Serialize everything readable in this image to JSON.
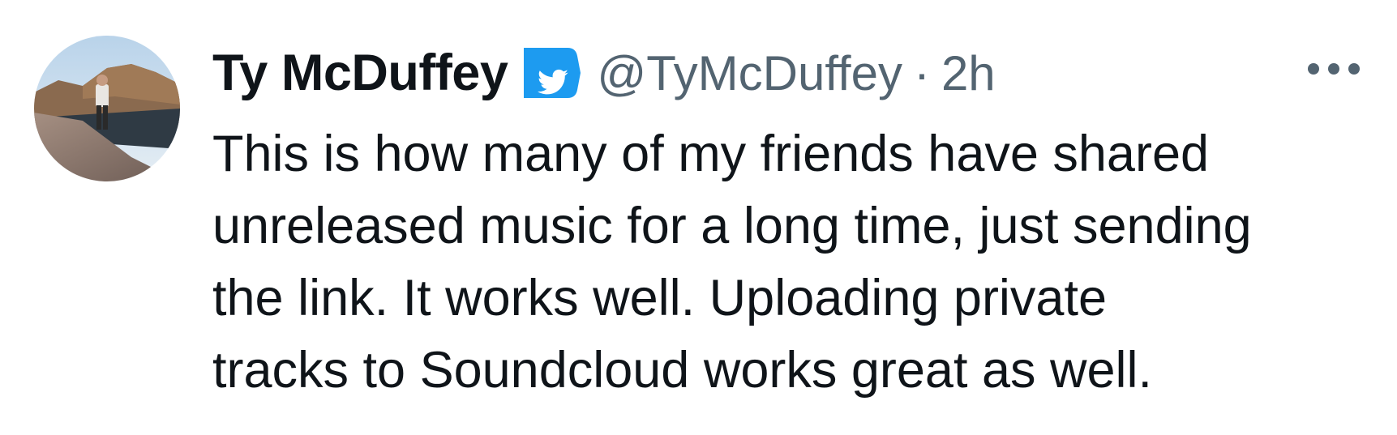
{
  "tweet": {
    "author": {
      "display_name": "Ty McDuffey",
      "handle": "@TyMcDuffey",
      "verified": true,
      "avatar_icon": "profile-photo-landscape"
    },
    "separator": "·",
    "timestamp": "2h",
    "more_icon": "more-horizontal-icon",
    "text": "This is how many of my friends have shared\nunreleased music for a long time, just sending\nthe link. It works well. Uploading private\ntracks to Soundcloud works great as well."
  },
  "colors": {
    "text_primary": "#0f1419",
    "text_secondary": "#536471",
    "verified_blue": "#1d9bf0",
    "background": "#ffffff"
  }
}
